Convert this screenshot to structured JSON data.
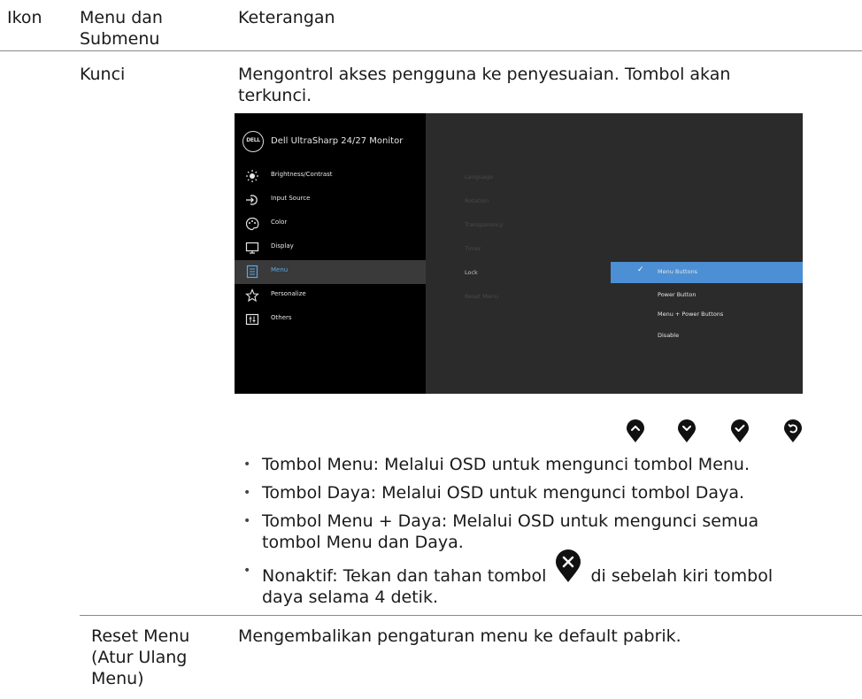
{
  "header": {
    "col1": "Ikon",
    "col2": "Menu dan Submenu",
    "col3": "Keterangan"
  },
  "lock_row": {
    "menu": "Kunci",
    "desc": "Mengontrol akses pengguna ke penyesuaian. Tombol akan terkunci."
  },
  "osd": {
    "logo": "DELL",
    "title": "Dell UltraSharp 24/27 Monitor",
    "menu_items": [
      {
        "label": "Brightness/Contrast",
        "icon": "sun-icon"
      },
      {
        "label": "Input Source",
        "icon": "input-source-icon"
      },
      {
        "label": "Color",
        "icon": "palette-icon"
      },
      {
        "label": "Display",
        "icon": "monitor-icon"
      },
      {
        "label": "Menu",
        "icon": "menu-list-icon"
      },
      {
        "label": "Personalize",
        "icon": "star-icon"
      },
      {
        "label": "Others",
        "icon": "sliders-icon"
      }
    ],
    "submenu": [
      "Language",
      "Rotation",
      "Transparency",
      "Timer",
      "Lock",
      "Reset Menu"
    ],
    "options": [
      "Menu Buttons",
      "Power Button",
      "Menu + Power Buttons",
      "Disable"
    ],
    "colors": {
      "highlight": "#4d8fd4",
      "accent": "#5aa7e6",
      "panel": "#2b2b2b"
    }
  },
  "nav_buttons": [
    "chevron-up-icon",
    "chevron-down-icon",
    "check-icon",
    "back-icon"
  ],
  "bullets": {
    "b1": "Tombol Menu: Melalui OSD untuk mengunci tombol Menu.",
    "b2": "Tombol Daya: Melalui OSD untuk mengunci tombol Daya.",
    "b3": "Tombol Menu + Daya: Melalui OSD untuk mengunci semua tombol Menu dan Daya.",
    "b4_pre": "Nonaktif: Tekan dan tahan tombol",
    "b4_post": "di sebelah kiri tombol daya selama 4 detik."
  },
  "reset_row": {
    "menu": "Reset Menu (Atur Ulang Menu)",
    "desc": "Mengembalikan pengaturan menu ke default pabrik."
  }
}
